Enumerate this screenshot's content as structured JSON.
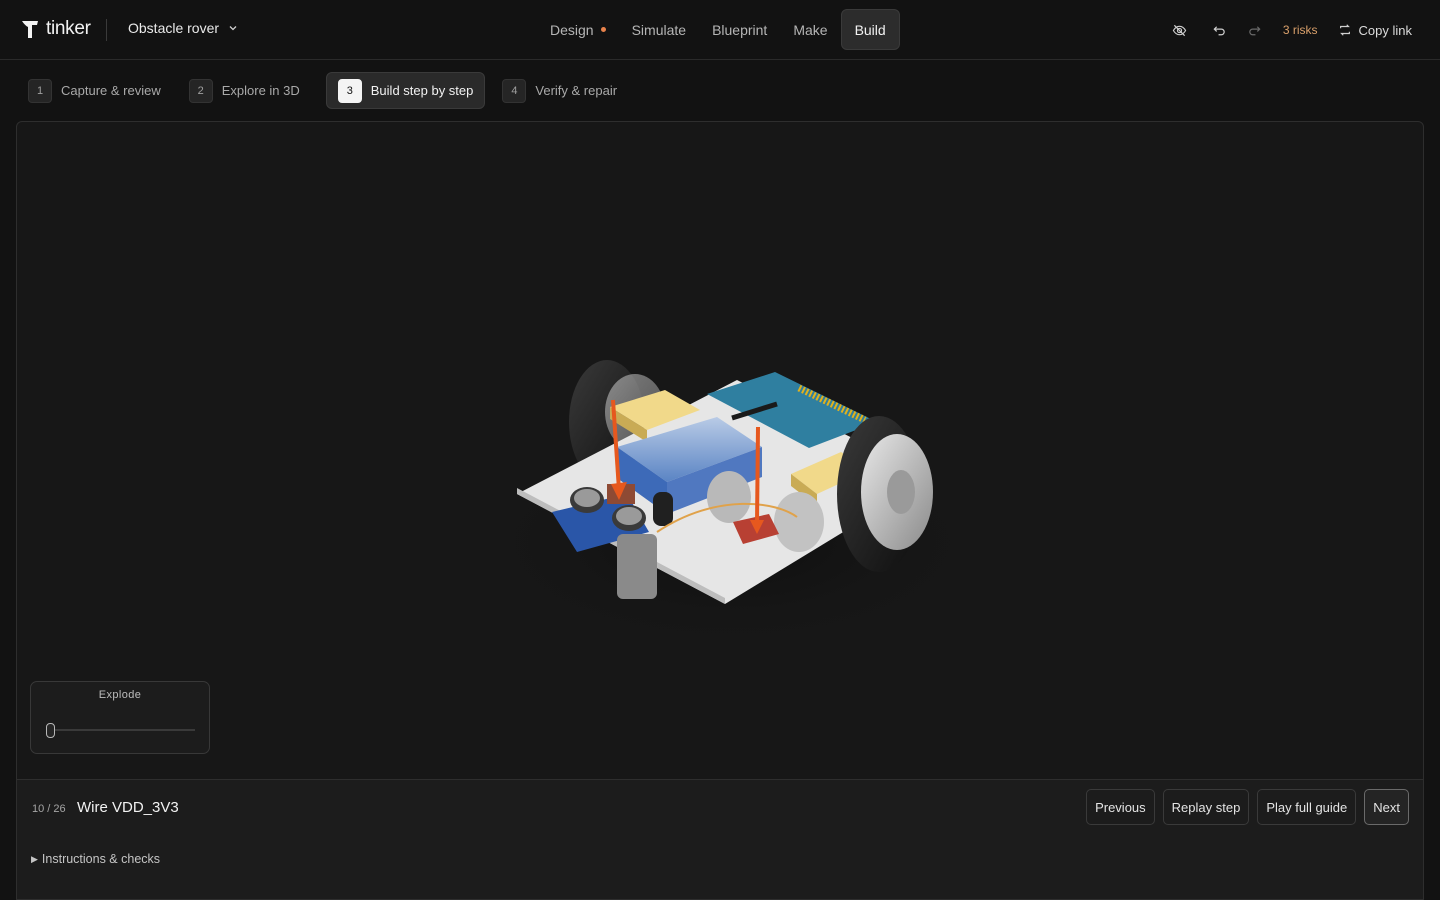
{
  "brand": {
    "name": "tinker",
    "logo_icon": "tinker-logo-icon"
  },
  "project": {
    "name": "Obstacle rover",
    "dropdown_icon": "chevron-down-icon"
  },
  "nav": {
    "items": [
      {
        "label": "Design",
        "has_dot": true
      },
      {
        "label": "Simulate"
      },
      {
        "label": "Blueprint"
      },
      {
        "label": "Make"
      },
      {
        "label": "Build",
        "active": true
      }
    ],
    "dot_color": "#e8824b"
  },
  "toolbar": {
    "visibility_icon": "eye-off-icon",
    "undo_icon": "undo-icon",
    "redo_icon": "redo-icon",
    "risks_label": "3 risks",
    "risks_color": "#d9a06b",
    "copy_link_label": "Copy link",
    "copy_link_icon": "link-icon"
  },
  "steps": [
    {
      "num": "1",
      "label": "Capture & review"
    },
    {
      "num": "2",
      "label": "Explore in 3D"
    },
    {
      "num": "3",
      "label": "Build step by step",
      "active": true
    },
    {
      "num": "4",
      "label": "Verify & repair"
    }
  ],
  "viewer": {
    "explode_label": "Explode",
    "explode_value": 0
  },
  "footer": {
    "counter": "10 / 26",
    "title": "Wire VDD_3V3",
    "buttons": {
      "previous": "Previous",
      "replay": "Replay step",
      "play": "Play full guide",
      "next": "Next"
    },
    "instructions_label": "Instructions & checks"
  }
}
